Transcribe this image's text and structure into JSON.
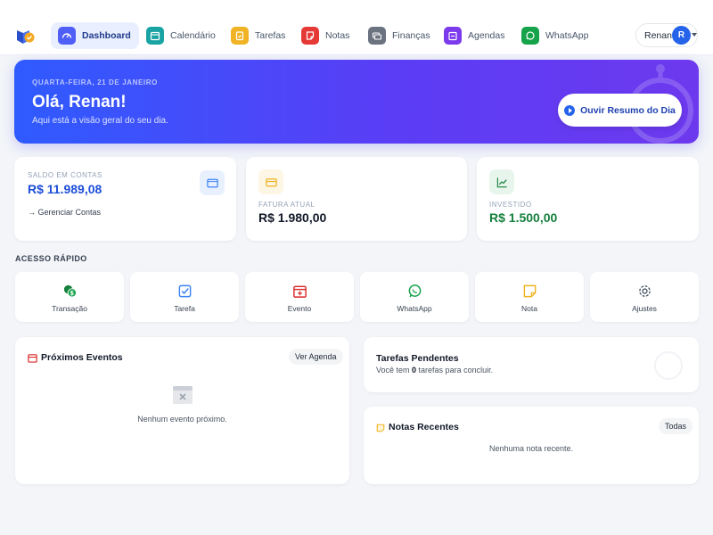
{
  "nav": {
    "items": [
      {
        "label": "Dashboard",
        "icon": "gauge-icon",
        "color": "#4f5ef7",
        "active": true
      },
      {
        "label": "Calendário",
        "icon": "calendar-icon",
        "color": "#1aa3a3"
      },
      {
        "label": "Tarefas",
        "icon": "clipboard-icon",
        "color": "#f0b323"
      },
      {
        "label": "Notas",
        "icon": "note-icon",
        "color": "#e53935"
      },
      {
        "label": "Finanças",
        "icon": "money-icon",
        "color": "#6b7280"
      },
      {
        "label": "Agendas",
        "icon": "agenda-icon",
        "color": "#7c3aed"
      },
      {
        "label": "WhatsApp",
        "icon": "whatsapp-icon",
        "color": "#16a34a"
      }
    ],
    "user": {
      "name": "Renan",
      "initial": "R"
    }
  },
  "hero": {
    "date": "QUARTA-FEIRA, 21 DE JANEIRO",
    "greeting": "Olá, Renan!",
    "subtitle": "Aqui está a visão geral do seu dia.",
    "button_label": "Ouvir Resumo do Dia"
  },
  "stats": {
    "saldo": {
      "label": "SALDO EM CONTAS",
      "value": "R$ 11.989,08",
      "link": "→ Gerenciar Contas",
      "color": "#1d4ed8"
    },
    "fatura": {
      "label": "FATURA ATUAL",
      "value": "R$ 1.980,00",
      "color": "#111827"
    },
    "investido": {
      "label": "INVESTIDO",
      "value": "R$ 1.500,00",
      "color": "#15803d"
    }
  },
  "quick_access": {
    "title": "ACESSO RÁPIDO",
    "items": [
      {
        "label": "Transação",
        "icon": "money-transfer-icon"
      },
      {
        "label": "Tarefa",
        "icon": "checkbox-icon"
      },
      {
        "label": "Evento",
        "icon": "calendar-plus-icon"
      },
      {
        "label": "WhatsApp",
        "icon": "whatsapp-icon"
      },
      {
        "label": "Nota",
        "icon": "sticky-note-icon"
      },
      {
        "label": "Ajustes",
        "icon": "gear-icon"
      }
    ]
  },
  "events": {
    "title": "Próximos Eventos",
    "button": "Ver Agenda",
    "empty": "Nenhum evento próximo."
  },
  "tasks": {
    "title": "Tarefas Pendentes",
    "text_before": "Você tem ",
    "count": "0",
    "text_after": " tarefas para concluir."
  },
  "notes": {
    "title": "Notas Recentes",
    "button": "Todas",
    "empty": "Nenhuma nota recente."
  }
}
